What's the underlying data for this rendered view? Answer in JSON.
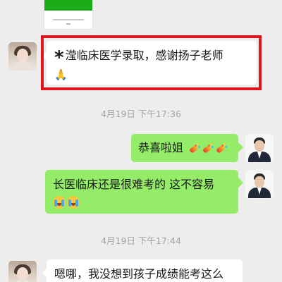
{
  "messages": {
    "m1": {
      "prefix": "*",
      "text": "滢临床医学录取，感谢扬子老师",
      "emoji": "🙏"
    },
    "ts1": "4月19日 下午17:36",
    "m2": {
      "text": "恭喜啦姐",
      "emoji": "firecracker"
    },
    "m3": {
      "line1": "长医临床还是很难考的 这不容易",
      "emoji": "crying-face"
    },
    "ts2": "4月19日 下午17:44",
    "m4": {
      "text": "嗯哪，我没想到孩子成绩能考这么"
    }
  },
  "colors": {
    "background": "#ededed",
    "bubble_sent": "#95ec69",
    "bubble_received": "#ffffff",
    "highlight": "#e0161c",
    "timestamp": "#a3a3a3"
  },
  "icons": [
    "avatar-parent",
    "avatar-teacher",
    "pray-emoji",
    "firecracker-emoji",
    "crying-face-emoji"
  ]
}
